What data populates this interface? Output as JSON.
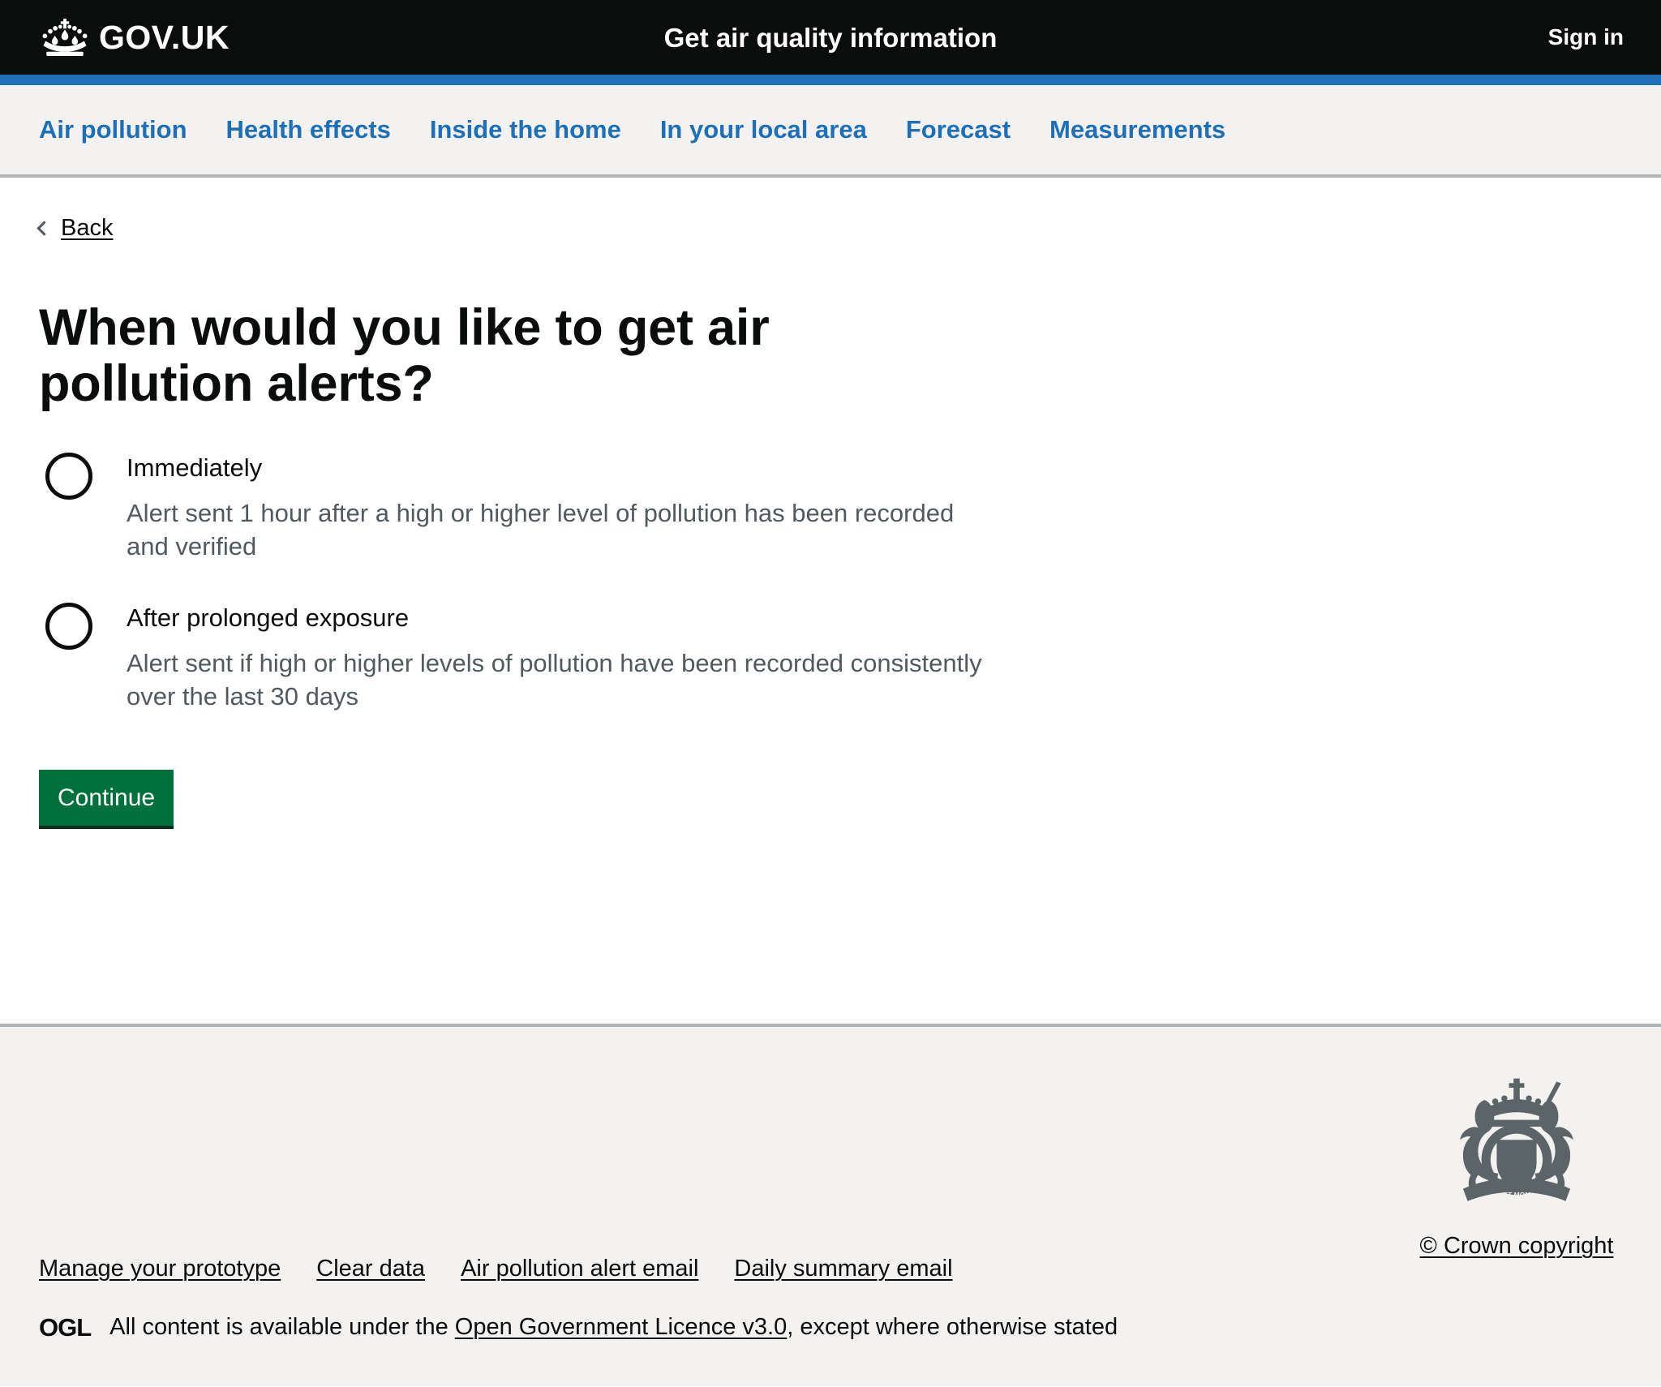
{
  "header": {
    "logo_text": "GOV.UK",
    "logo_icon": "crown-icon",
    "service_name": "Get air quality information",
    "sign_in_label": "Sign in",
    "background": "#0b0c0c",
    "accent": "#1d70b8"
  },
  "nav": {
    "items": [
      {
        "label": "Air pollution"
      },
      {
        "label": "Health effects"
      },
      {
        "label": "Inside the home"
      },
      {
        "label": "In your local area"
      },
      {
        "label": "Forecast"
      },
      {
        "label": "Measurements"
      }
    ],
    "link_color": "#1d70b8",
    "background": "#f3f2f1"
  },
  "main": {
    "back_label": "Back",
    "heading": "When would you like to get air pollution alerts?",
    "radios": [
      {
        "label": "Immediately",
        "hint": "Alert sent 1 hour after a high or higher level of pollution has been recorded and verified",
        "selected": false
      },
      {
        "label": "After prolonged exposure",
        "hint": "Alert sent if high or higher levels of pollution have been recorded consistently over the last 30 days",
        "selected": false
      }
    ],
    "continue_label": "Continue",
    "continue_color": "#00703c"
  },
  "footer": {
    "links": [
      {
        "label": "Manage your prototype"
      },
      {
        "label": "Clear data"
      },
      {
        "label": "Air pollution alert email"
      },
      {
        "label": "Daily summary email"
      }
    ],
    "ogl_logo": "OGL",
    "licence_prefix": "All content is available under the",
    "licence_link": "Open Government Licence v3.0",
    "licence_suffix": ", except where otherwise stated",
    "crown_copyright": "© Crown copyright",
    "crest_icon": "royal-coat-of-arms-icon",
    "background": "#f3f2f1"
  }
}
